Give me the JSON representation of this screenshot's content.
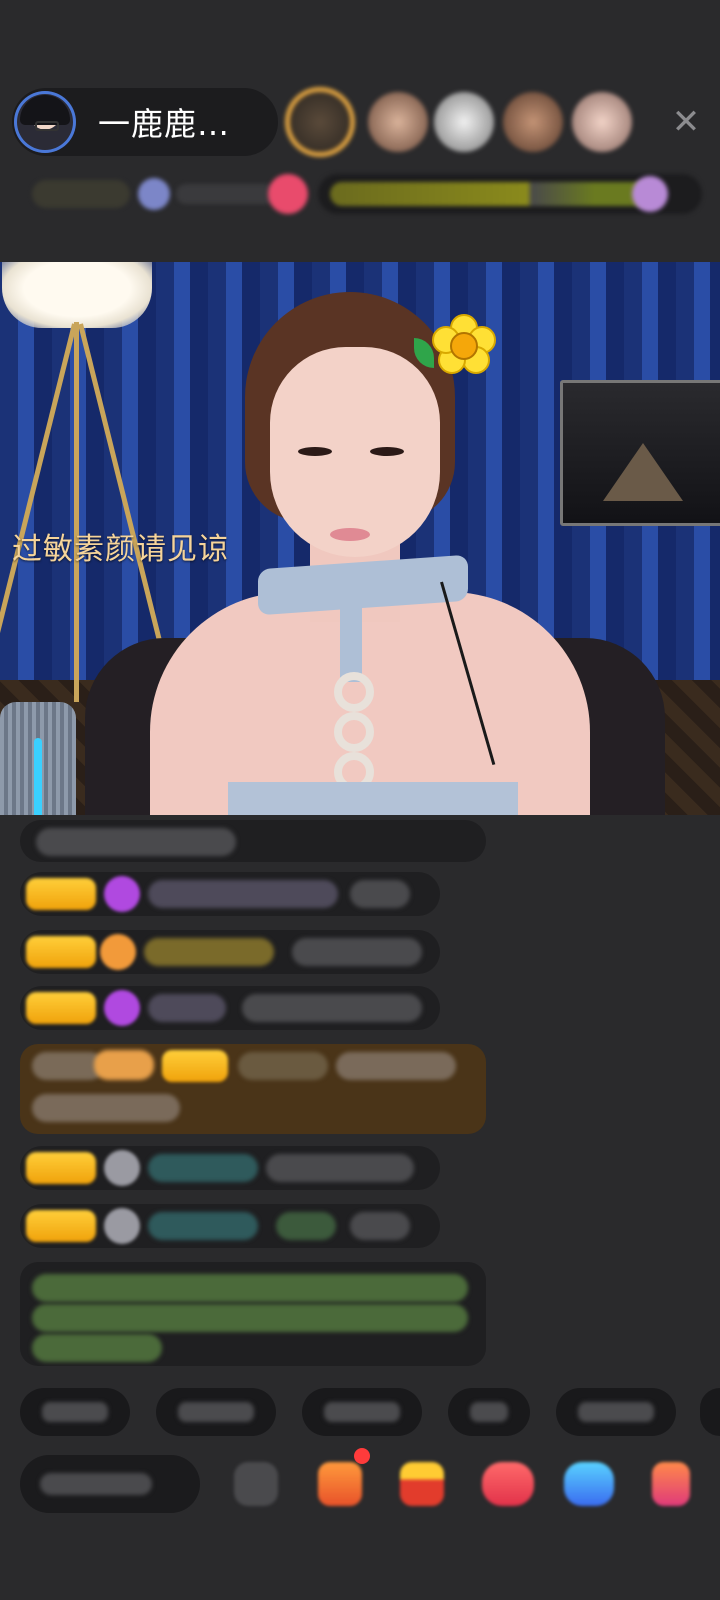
{
  "header": {
    "host_name": "一鹿鹿…",
    "close_icon": "close-icon",
    "viewer_count_avatars": 5
  },
  "video": {
    "caption": "过敏素颜请见谅"
  },
  "chat": {
    "row_count": 8
  },
  "bottom": {
    "quick_reply_count": 6,
    "tool_icons": [
      "emoji-icon",
      "gift-box-icon",
      "treasure-chest-icon",
      "red-packet-icon",
      "game-controller-icon",
      "gift-icon"
    ]
  }
}
